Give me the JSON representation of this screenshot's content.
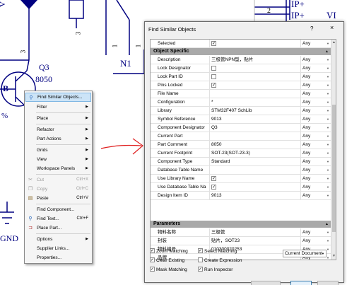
{
  "schematic": {
    "labels": {
      "q3": "Q3",
      "part_8050": "8050",
      "b": "B",
      "n1": "N1",
      "gnd": "GND",
      "ip1": "IP+",
      "ip2": "IP+",
      "vi": "VI",
      "pin2": "2",
      "pin3": "3",
      "pin1a": "1",
      "pin1b": "1",
      "pin3b": "3",
      "pct": "%",
      "v": "V"
    }
  },
  "context_menu": {
    "items": [
      {
        "label": "Find Similar Objects...",
        "highlighted": true,
        "icon": "find-similar-icon"
      },
      {
        "label": "Filter",
        "submenu": true
      },
      {
        "label": "Place",
        "submenu": true
      },
      {
        "label": "Refactor",
        "submenu": true
      },
      {
        "label": "Part Actions",
        "submenu": true
      },
      {
        "label": "Grids",
        "submenu": true
      },
      {
        "label": "View",
        "submenu": true
      },
      {
        "label": "Workspace Panels",
        "submenu": true
      },
      {
        "label": "Cut",
        "shortcut": "Ctrl+X",
        "disabled": true
      },
      {
        "label": "Copy",
        "shortcut": "Ctrl+C",
        "disabled": true
      },
      {
        "label": "Paste",
        "shortcut": "Ctrl+V"
      },
      {
        "label": "Find Component..."
      },
      {
        "label": "Find Text...",
        "shortcut": "Ctrl+F"
      },
      {
        "label": "Place Part..."
      },
      {
        "label": "Options",
        "submenu": true
      },
      {
        "label": "Supplier Links..."
      },
      {
        "label": "Properties..."
      }
    ]
  },
  "dialog": {
    "title": "Find Similar Objects",
    "help": "?",
    "close": "×",
    "selected_row": {
      "label": "Selected",
      "checked": true,
      "match": "Any"
    },
    "object_specific": {
      "header": "Object Specific",
      "rows": [
        {
          "label": "Description",
          "value": "三极管NPN型，贴片",
          "match": "Any"
        },
        {
          "label": "Lock Designator",
          "checkbox": true,
          "checked": false,
          "match": "Any"
        },
        {
          "label": "Lock Part ID",
          "checkbox": true,
          "checked": false,
          "match": "Any"
        },
        {
          "label": "Pins Locked",
          "checkbox": true,
          "checked": true,
          "match": "Any"
        },
        {
          "label": "File Name",
          "value": "",
          "match": "Any"
        },
        {
          "label": "Configuration",
          "value": "*",
          "match": "Any"
        },
        {
          "label": "Library",
          "value": "STM32F407 SchLib",
          "match": "Any"
        },
        {
          "label": "Symbol Reference",
          "value": "9013",
          "match": "Any"
        },
        {
          "label": "Component Designator",
          "value": "Q3",
          "match": "Any"
        },
        {
          "label": "Current Part",
          "value": "",
          "match": "Any"
        },
        {
          "label": "Part Comment",
          "value": "8050",
          "match": "Any"
        },
        {
          "label": "Current Footprint",
          "value": "SOT-23(SOT-23-3)",
          "match": "Any"
        },
        {
          "label": "Component Type",
          "value": "Standard",
          "match": "Any"
        },
        {
          "label": "Database Table Name",
          "value": "",
          "match": "Any"
        },
        {
          "label": "Use Library Name",
          "checkbox": true,
          "checked": true,
          "match": "Any"
        },
        {
          "label": "Use Database Table Na",
          "checkbox": true,
          "checked": true,
          "match": "Any"
        },
        {
          "label": "Design Item ID",
          "value": "9013",
          "match": "Any"
        }
      ]
    },
    "parameters": {
      "header": "Parameters",
      "rows": [
        {
          "label": "物料名称",
          "value": "三极管",
          "match": "Any"
        },
        {
          "label": "封装",
          "value": "贴片，SOT23",
          "match": "Any"
        },
        {
          "label": "物料编号",
          "value": "010300020253",
          "match": "Any"
        },
        {
          "label": "品牌",
          "value": "",
          "match": "Any"
        }
      ]
    },
    "options": {
      "zoom_matching": {
        "label": "Zoom Matching",
        "checked": true
      },
      "select_matching": {
        "label": "Select Matching",
        "checked": true
      },
      "clear_existing": {
        "label": "Clear Existing",
        "checked": true
      },
      "create_expression": {
        "label": "Create Expression",
        "checked": false
      },
      "mask_matching": {
        "label": "Mask Matching",
        "checked": true
      },
      "run_inspector": {
        "label": "Run Inspector",
        "checked": true
      },
      "scope": "Current Document"
    }
  }
}
